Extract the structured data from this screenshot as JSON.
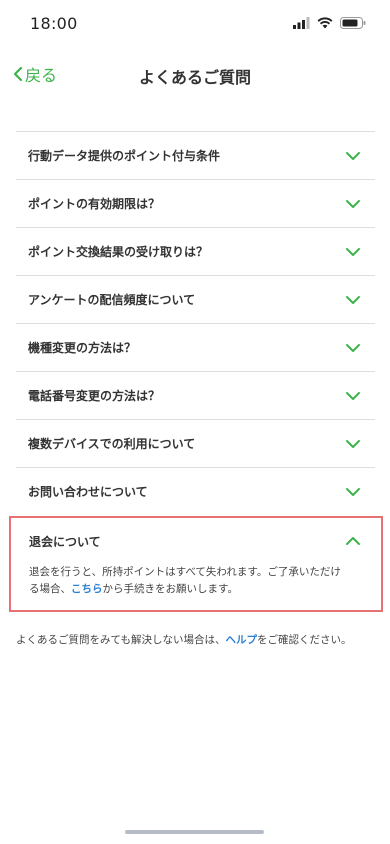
{
  "status": {
    "time": "18:00"
  },
  "header": {
    "back_label": "戻る",
    "title": "よくあるご質問"
  },
  "faq": {
    "items": [
      {
        "question": "行動データ提供のポイント付与条件"
      },
      {
        "question": "ポイントの有効期限は？"
      },
      {
        "question": "ポイント交換結果の受け取りは？"
      },
      {
        "question": "アンケートの配信頻度について"
      },
      {
        "question": "機種変更の方法は？"
      },
      {
        "question": "電話番号変更の方法は？"
      },
      {
        "question": "複数デバイスでの利用について"
      },
      {
        "question": "お問い合わせについて"
      }
    ],
    "open_item": {
      "question": "退会について",
      "answer_before": "退会を行うと、所持ポイントはすべて失われます。ご了承いただける場合、",
      "answer_link": "こちら",
      "answer_after": "から手続きをお願いします。"
    }
  },
  "footer": {
    "before": "よくあるご質問をみても解決しない場合は、",
    "link": "ヘルプ",
    "after": "をご確認ください。"
  },
  "colors": {
    "accent": "#3db34a",
    "link": "#2a7fd4",
    "highlight_border": "#e57373"
  }
}
